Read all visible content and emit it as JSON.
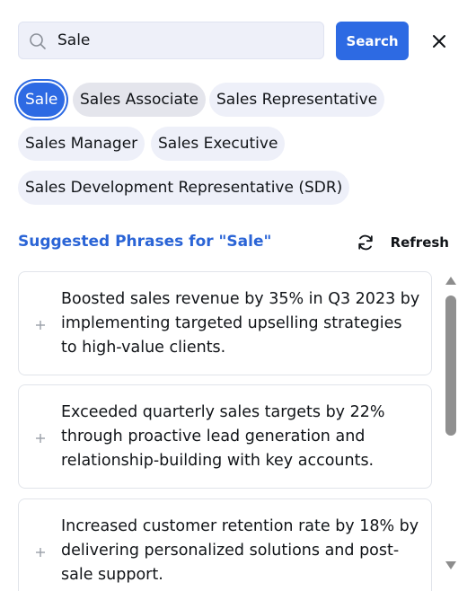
{
  "search": {
    "value": "Sale",
    "button_label": "Search"
  },
  "chips": [
    {
      "label": "Sale",
      "state": "selected"
    },
    {
      "label": "Sales Associate",
      "state": "hover"
    },
    {
      "label": "Sales Representative",
      "state": "normal"
    },
    {
      "label": "Sales Manager",
      "state": "normal"
    },
    {
      "label": "Sales Executive",
      "state": "normal"
    },
    {
      "label": "Sales Development Representative (SDR)",
      "state": "normal"
    }
  ],
  "suggestions": {
    "title": "Suggested Phrases for \"Sale\"",
    "refresh_label": "Refresh",
    "phrases": [
      {
        "text": "Boosted sales revenue by 35% in Q3 2023 by implementing targeted upselling strategies to high-value clients."
      },
      {
        "text": "Exceeded quarterly sales targets by 22% through proactive lead generation and relationship-building with key accounts."
      },
      {
        "text": "Increased customer retention rate by 18% by delivering personalized solutions and post-sale support."
      }
    ]
  },
  "icons": {
    "search": "search-icon",
    "close": "close-icon",
    "refresh": "refresh-icon",
    "add": "plus-icon"
  },
  "colors": {
    "accent": "#2d6ae3",
    "title": "#2a64d6",
    "chip_bg": "#eef0f9",
    "card_border": "#e1e4ea"
  }
}
